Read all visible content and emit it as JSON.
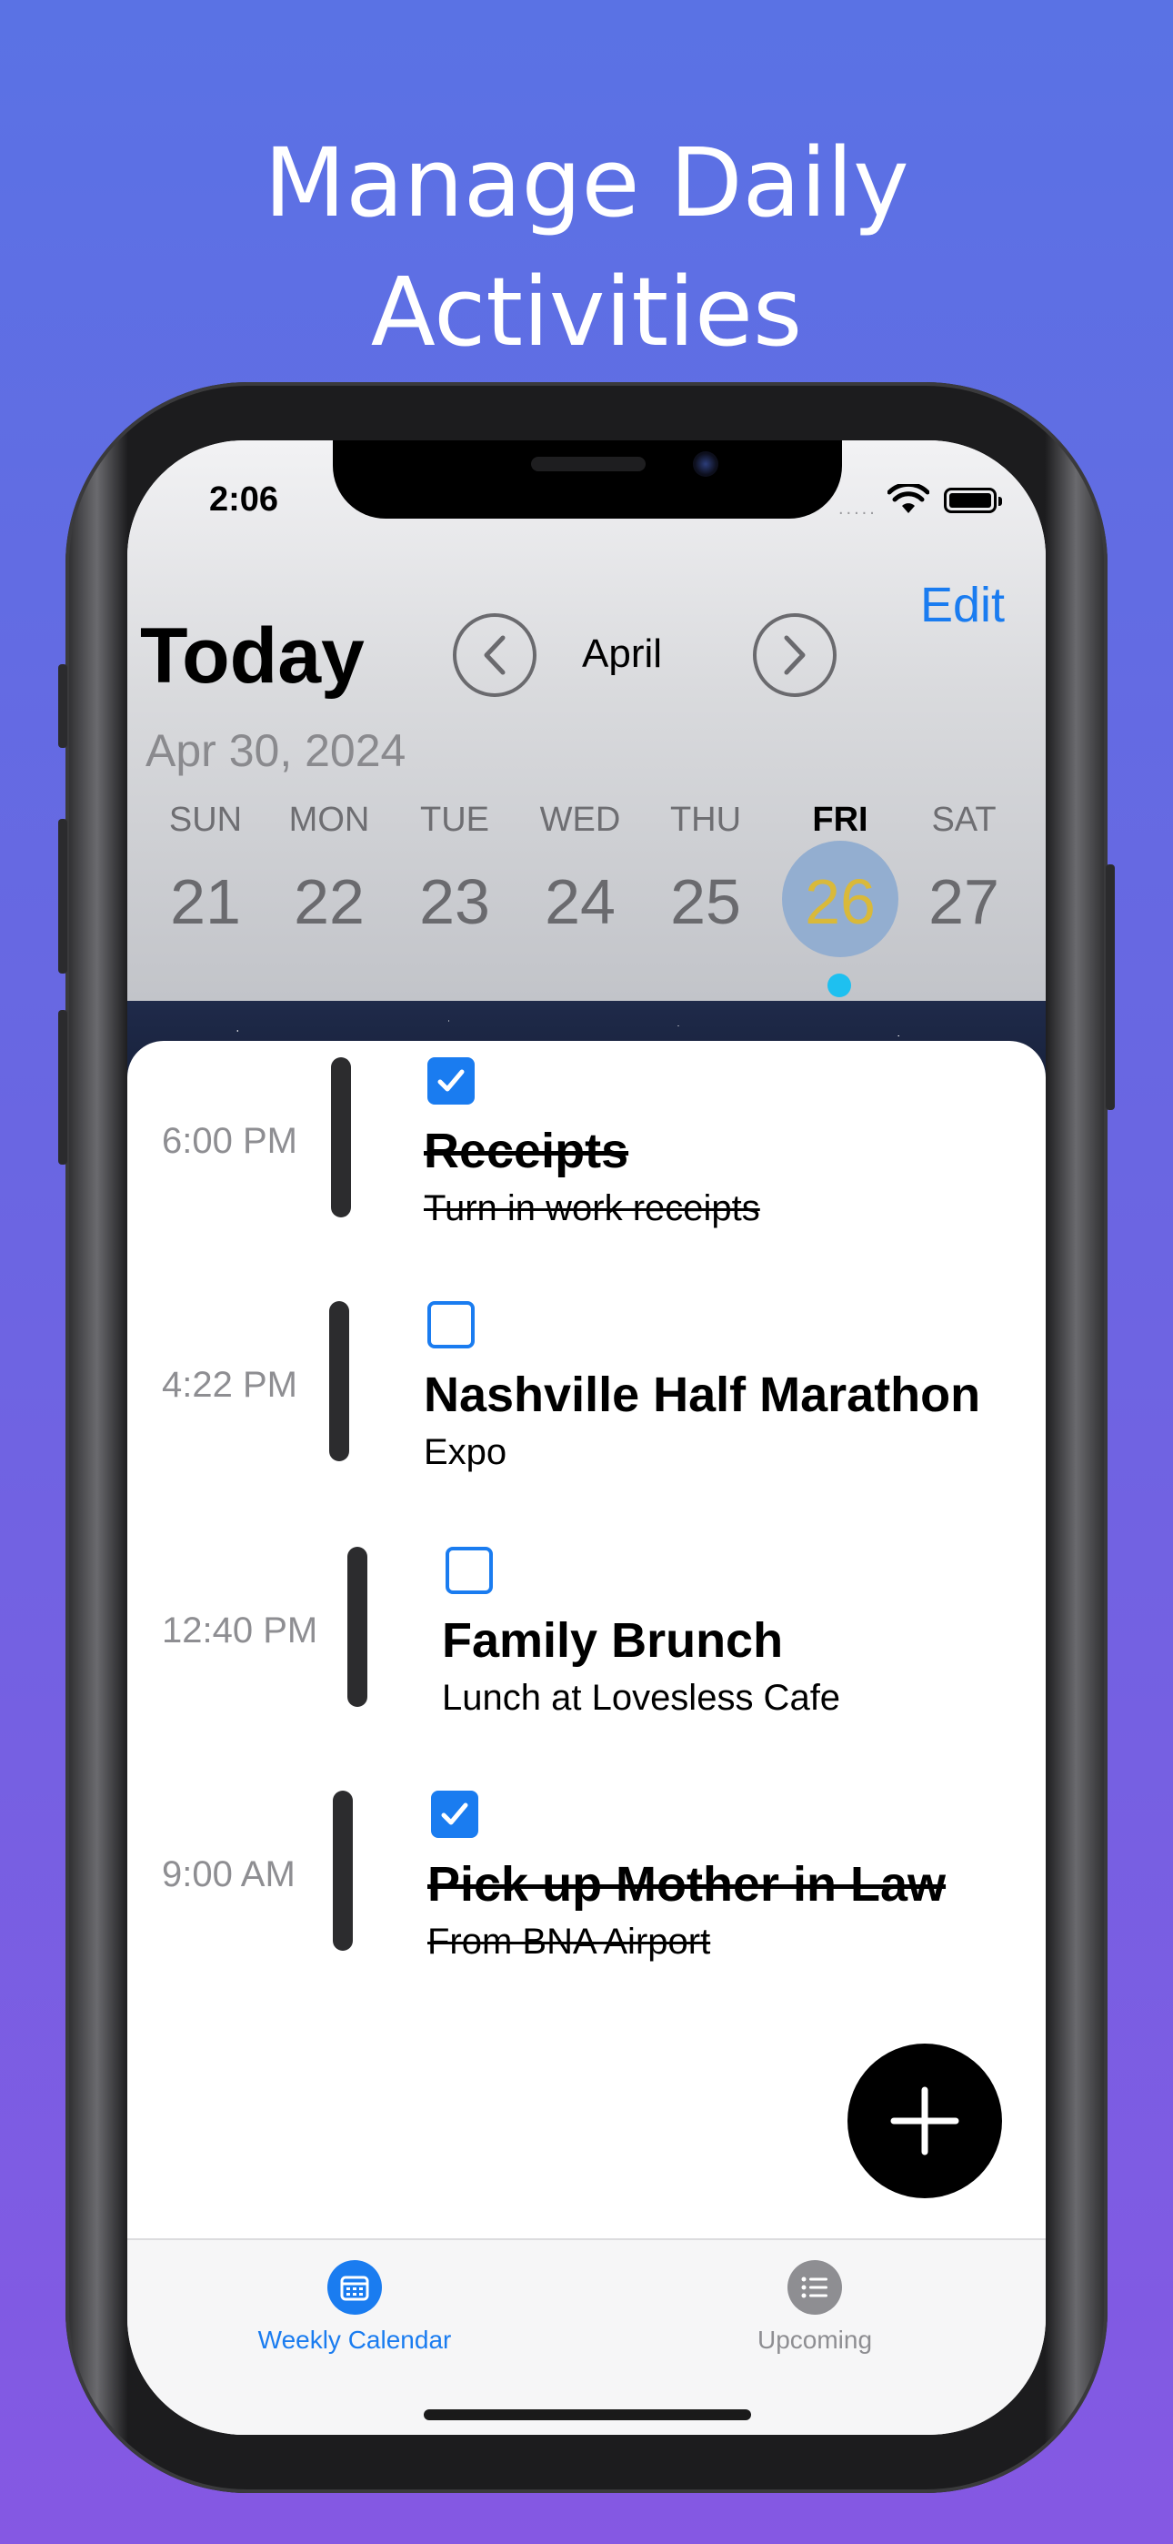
{
  "headline": {
    "line1": "Manage Daily",
    "line2": "Activities"
  },
  "status_bar": {
    "time": "2:06",
    "signal": "....."
  },
  "header": {
    "edit_label": "Edit",
    "title": "Today",
    "month": "April",
    "date": "Apr 30, 2024"
  },
  "week": {
    "days": [
      {
        "name": "SUN",
        "num": "21"
      },
      {
        "name": "MON",
        "num": "22"
      },
      {
        "name": "TUE",
        "num": "23"
      },
      {
        "name": "WED",
        "num": "24"
      },
      {
        "name": "THU",
        "num": "25"
      },
      {
        "name": "FRI",
        "num": "26"
      },
      {
        "name": "SAT",
        "num": "27"
      }
    ],
    "selected_index": 5
  },
  "events": [
    {
      "time": "6:00 PM",
      "title": "Receipts",
      "subtitle": "Turn in work receipts",
      "done": true
    },
    {
      "time": "4:22 PM",
      "title": "Nashville Half Marathon",
      "subtitle": "Expo",
      "done": false
    },
    {
      "time": "12:40 PM",
      "title": "Family Brunch",
      "subtitle": "Lunch at Lovesless Cafe",
      "done": false
    },
    {
      "time": "9:00 AM",
      "title": "Pick up Mother in Law",
      "subtitle": "From BNA Airport",
      "done": true
    }
  ],
  "tabs": [
    {
      "label": "Weekly Calendar",
      "icon": "calendar-icon",
      "active": true
    },
    {
      "label": "Upcoming",
      "icon": "list-icon",
      "active": false
    }
  ],
  "colors": {
    "accent": "#1a7cf0",
    "selected_day_bg": "#93aed0",
    "selected_day_text": "#d9b93a",
    "event_dot": "#1ec0f0",
    "inactive_tab": "#8e8e92"
  }
}
